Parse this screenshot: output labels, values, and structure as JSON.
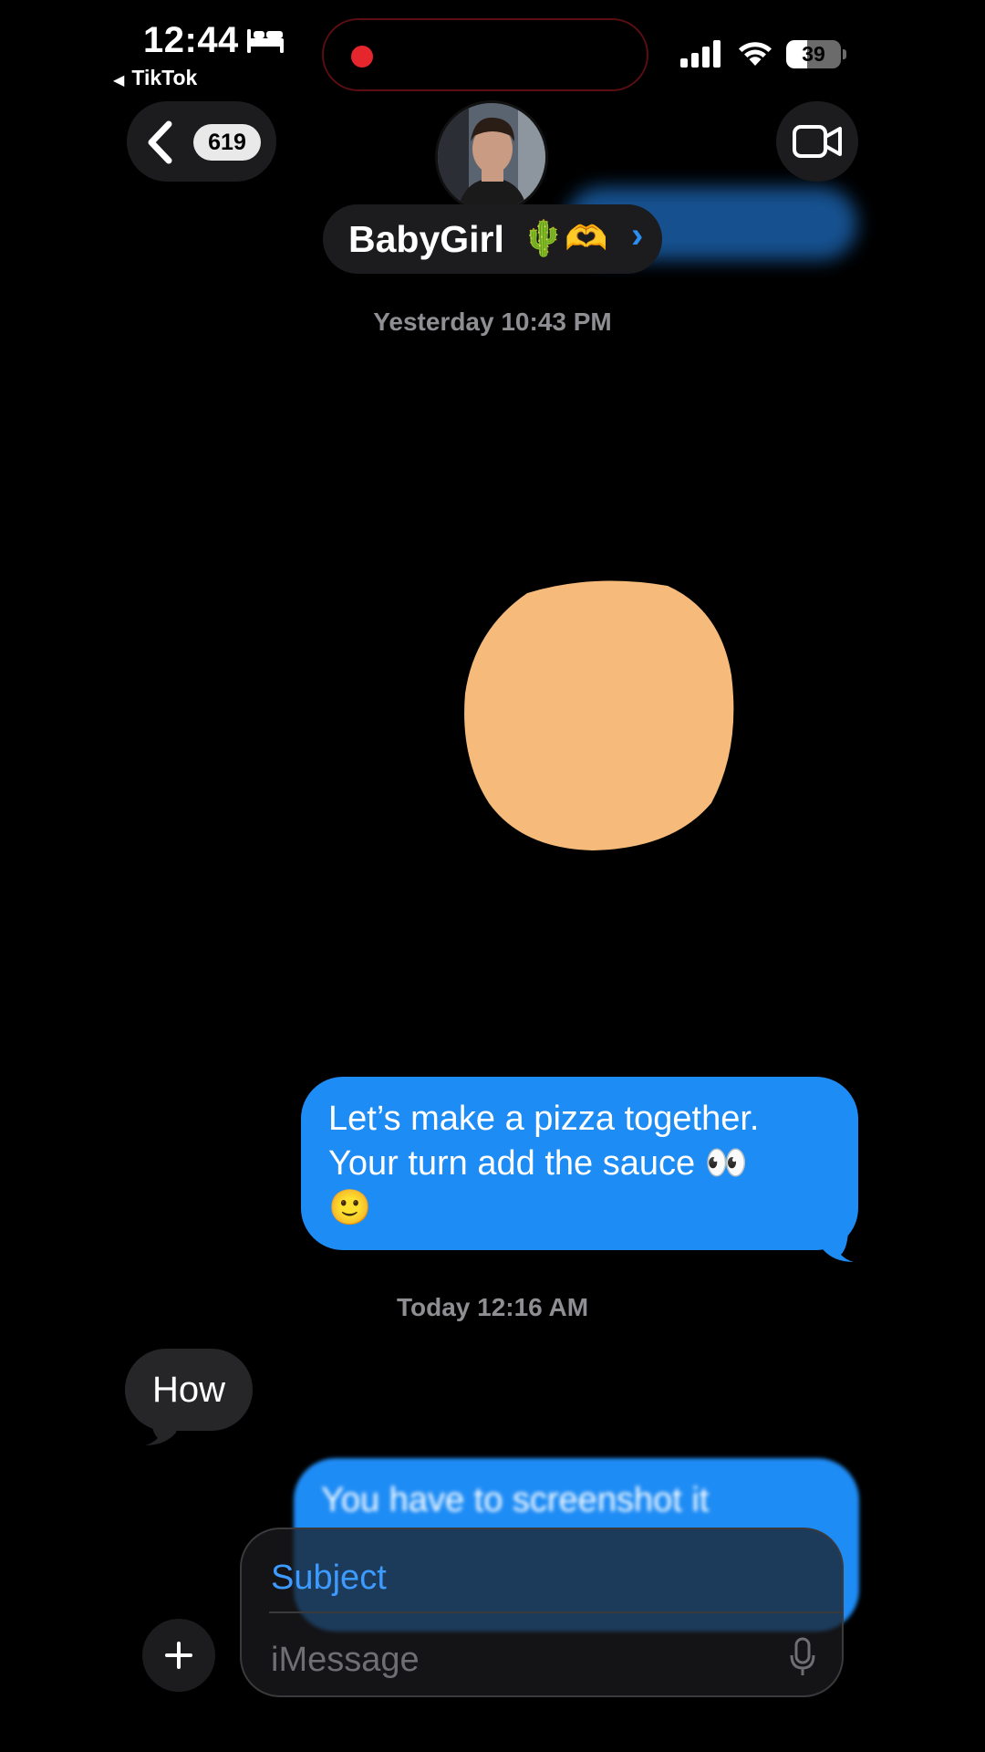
{
  "status_bar": {
    "time": "12:44",
    "back_app": "TikTok",
    "battery": "39",
    "battery_level": 0.39,
    "icons": [
      "bed-icon",
      "recording-dot-icon",
      "cellular-signal-icon",
      "wifi-icon",
      "battery-icon"
    ]
  },
  "header": {
    "unread_count": "619",
    "contact_name": "BabyGirl",
    "contact_emoji": "🌵🫶",
    "icons": [
      "chevron-left-icon",
      "video-call-icon",
      "chevron-right-icon"
    ]
  },
  "thread": {
    "timestamp_1": "Yesterday 10:43 PM",
    "outgoing_1": [
      "Let’s make a pizza together.",
      "Your turn add the sauce 👀",
      "🙂"
    ],
    "timestamp_2": "Today 12:16 AM",
    "incoming_1": "How",
    "outgoing_2": [
      "You have to screenshot it"
    ],
    "sketch_color": "#f6bb7b"
  },
  "compose": {
    "subject_placeholder": "Subject",
    "message_placeholder": "iMessage",
    "icons": [
      "plus-icon",
      "microphone-icon"
    ]
  },
  "colors": {
    "outgoing_bubble": "#1e8cf5",
    "incoming_bubble": "#262628",
    "background": "#000000"
  }
}
